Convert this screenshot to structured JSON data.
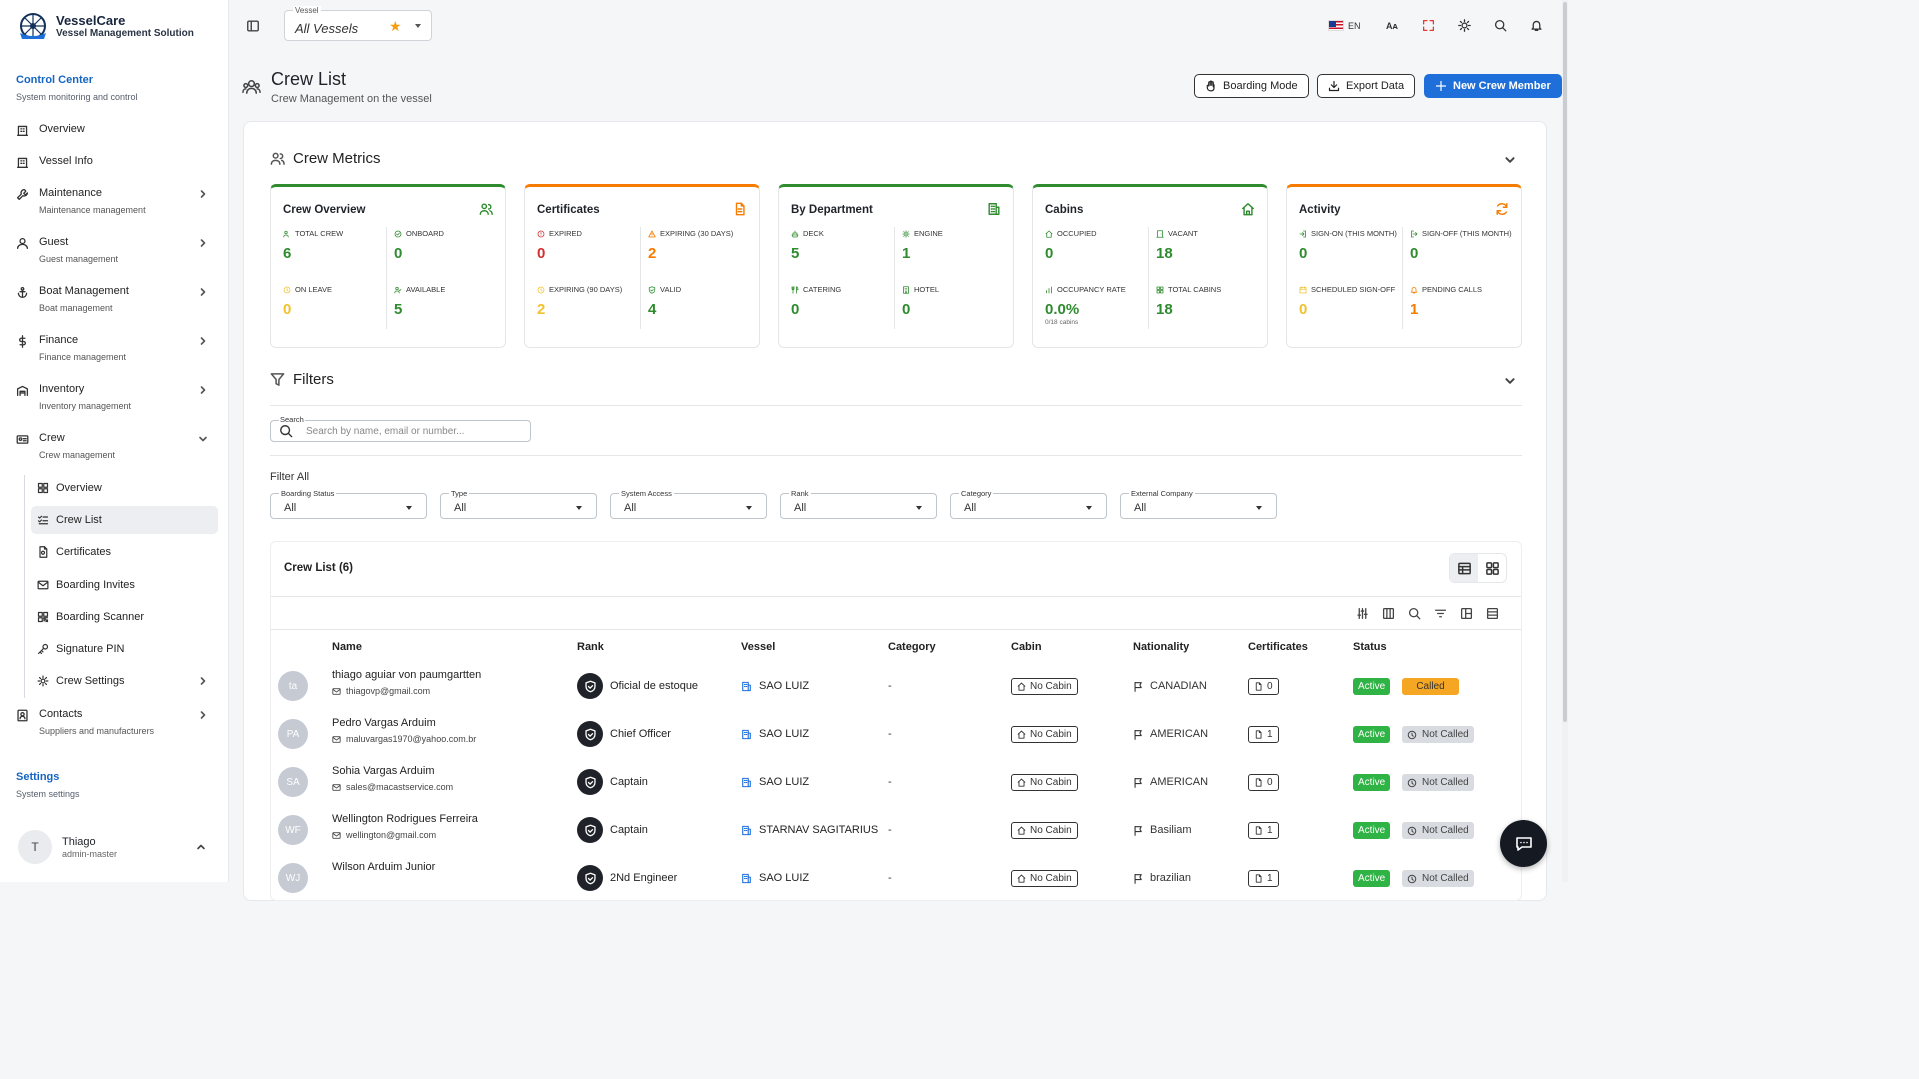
{
  "brand": {
    "name": "VesselCare",
    "tagline": "Vessel Management Solution"
  },
  "sidebar": {
    "control_center": {
      "title": "Control Center",
      "subtitle": "System monitoring and control"
    },
    "items": [
      {
        "label": "Overview",
        "sub": ""
      },
      {
        "label": "Vessel Info",
        "sub": ""
      },
      {
        "label": "Maintenance",
        "sub": "Maintenance management"
      },
      {
        "label": "Guest",
        "sub": "Guest management"
      },
      {
        "label": "Boat Management",
        "sub": "Boat management"
      },
      {
        "label": "Finance",
        "sub": "Finance management"
      },
      {
        "label": "Inventory",
        "sub": "Inventory management"
      },
      {
        "label": "Crew",
        "sub": "Crew management"
      },
      {
        "label": "Contacts",
        "sub": "Suppliers and manufacturers"
      }
    ],
    "crew_sub": [
      "Overview",
      "Crew List",
      "Certificates",
      "Boarding Invites",
      "Boarding Scanner",
      "Signature PIN",
      "Crew Settings"
    ],
    "settings": {
      "title": "Settings",
      "subtitle": "System settings"
    },
    "user": {
      "initial": "T",
      "name": "Thiago",
      "role": "admin-master"
    }
  },
  "topbar": {
    "vessel_label": "Vessel",
    "vessel_value": "All Vessels",
    "language": "EN",
    "font_icon_text": "Aᴀ"
  },
  "header": {
    "title": "Crew List",
    "subtitle": "Crew Management on the vessel",
    "buttons": {
      "boarding": "Boarding Mode",
      "export": "Export Data",
      "new": "New Crew Member"
    }
  },
  "metrics": {
    "title": "Crew Metrics",
    "cards": [
      {
        "title": "Crew Overview",
        "stats": [
          {
            "label": "TOTAL CREW",
            "value": "6"
          },
          {
            "label": "ONBOARD",
            "value": "0"
          },
          {
            "label": "ON LEAVE",
            "value": "0"
          },
          {
            "label": "AVAILABLE",
            "value": "5"
          }
        ]
      },
      {
        "title": "Certificates",
        "stats": [
          {
            "label": "EXPIRED",
            "value": "0"
          },
          {
            "label": "EXPIRING (30 DAYS)",
            "value": "2"
          },
          {
            "label": "EXPIRING (90 DAYS)",
            "value": "2"
          },
          {
            "label": "VALID",
            "value": "4"
          }
        ]
      },
      {
        "title": "By Department",
        "stats": [
          {
            "label": "DECK",
            "value": "5"
          },
          {
            "label": "ENGINE",
            "value": "1"
          },
          {
            "label": "CATERING",
            "value": "0"
          },
          {
            "label": "HOTEL",
            "value": "0"
          }
        ]
      },
      {
        "title": "Cabins",
        "stats": [
          {
            "label": "OCCUPIED",
            "value": "0"
          },
          {
            "label": "VACANT",
            "value": "18"
          },
          {
            "label": "OCCUPANCY RATE",
            "value": "0.0%",
            "foot": "0/18 cabins"
          },
          {
            "label": "TOTAL CABINS",
            "value": "18"
          }
        ]
      },
      {
        "title": "Activity",
        "stats": [
          {
            "label": "SIGN-ON (THIS MONTH)",
            "value": "0"
          },
          {
            "label": "SIGN-OFF (THIS MONTH)",
            "value": "0"
          },
          {
            "label": "SCHEDULED SIGN-OFF",
            "value": "0"
          },
          {
            "label": "PENDING CALLS",
            "value": "1"
          }
        ]
      }
    ]
  },
  "filters": {
    "title": "Filters",
    "search_label": "Search",
    "search_placeholder": "Search by name, email or number...",
    "filter_all": "Filter All",
    "dropdowns": [
      {
        "label": "Boarding Status",
        "value": "All"
      },
      {
        "label": "Type",
        "value": "All"
      },
      {
        "label": "System Access",
        "value": "All"
      },
      {
        "label": "Rank",
        "value": "All"
      },
      {
        "label": "Category",
        "value": "All"
      },
      {
        "label": "External Company",
        "value": "All"
      }
    ]
  },
  "table": {
    "title": "Crew List (6)",
    "columns": [
      "Name",
      "Rank",
      "Vessel",
      "Category",
      "Cabin",
      "Nationality",
      "Certificates",
      "Status"
    ],
    "rows": [
      {
        "initials": "ta",
        "name": "thiago aguiar von paumgartten",
        "email": "thiagovp@gmail.com",
        "rank": "Oficial de estoque",
        "vessel": "SAO LUIZ",
        "category": "-",
        "cabin": "No Cabin",
        "nationality": "CANADIAN",
        "certs": "0",
        "status": "Active",
        "call": "Called"
      },
      {
        "initials": "PA",
        "name": "Pedro Vargas Arduim",
        "email": "maluvargas1970@yahoo.com.br",
        "rank": "Chief Officer",
        "vessel": "SAO LUIZ",
        "category": "-",
        "cabin": "No Cabin",
        "nationality": "AMERICAN",
        "certs": "1",
        "status": "Active",
        "call": "Not Called"
      },
      {
        "initials": "SA",
        "name": "Sohia Vargas Arduim",
        "email": "sales@macastservice.com",
        "rank": "Captain",
        "vessel": "SAO LUIZ",
        "category": "-",
        "cabin": "No Cabin",
        "nationality": "AMERICAN",
        "certs": "0",
        "status": "Active",
        "call": "Not Called"
      },
      {
        "initials": "WF",
        "name": "Wellington Rodrigues Ferreira",
        "email": "wellington@gmail.com",
        "rank": "Captain",
        "vessel": "STARNAV SAGITARIUS",
        "category": "-",
        "cabin": "No Cabin",
        "nationality": "Basiliam",
        "certs": "1",
        "status": "Active",
        "call": "Not Called"
      },
      {
        "initials": "WJ",
        "name": "Wilson Arduim Junior",
        "email": "",
        "rank": "2Nd Engineer",
        "vessel": "SAO LUIZ",
        "category": "-",
        "cabin": "No Cabin",
        "nationality": "brazilian",
        "certs": "1",
        "status": "Active",
        "call": "Not Called"
      }
    ]
  },
  "colors": {
    "accent": "#1e6fd9",
    "green": "#2e8b2e",
    "orange": "#f57c00",
    "active": "#2fb344",
    "called": "#f5a623"
  }
}
